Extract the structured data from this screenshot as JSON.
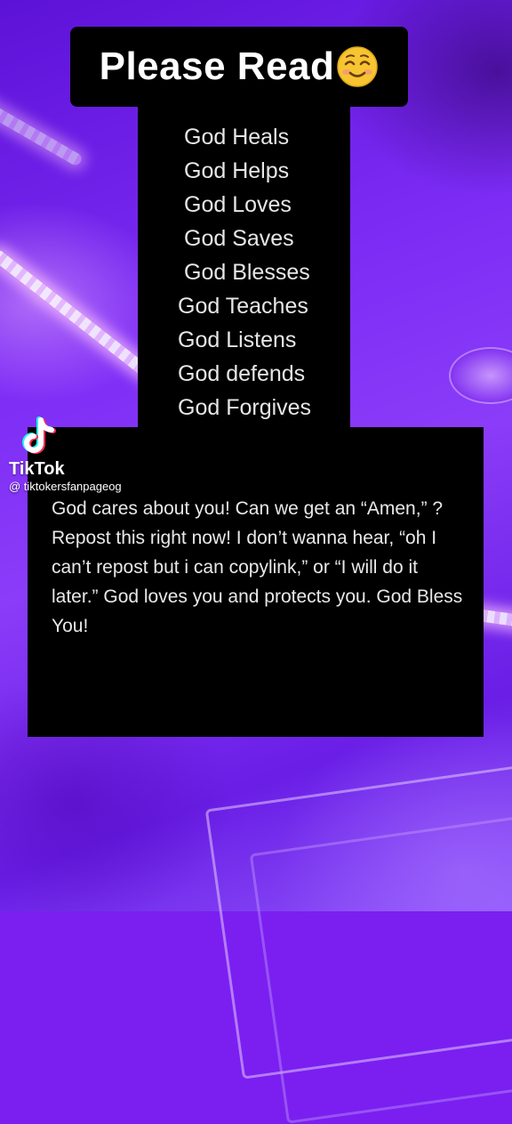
{
  "title": "Please Read",
  "title_emoji": "smiling-face-icon",
  "god_list": [
    "God Heals",
    "God Helps",
    "God Loves",
    "God Saves",
    "God Blesses",
    "God Teaches",
    "God Listens",
    "God defends",
    "God Forgives"
  ],
  "message": "God cares about you! Can we get an “Amen,” ? Repost this right now! I don’t wanna hear, “oh I can’t repost but i can copylink,” or “I will do it later.” God loves you and protects you. God Bless You!",
  "watermark": {
    "brand": "TikTok",
    "handle": "@ tiktokersfanpageog",
    "icon": "tiktok-logo-icon"
  },
  "colors": {
    "background": "#7a1ff0",
    "panel": "#000000",
    "text": "#e6e6e6"
  }
}
